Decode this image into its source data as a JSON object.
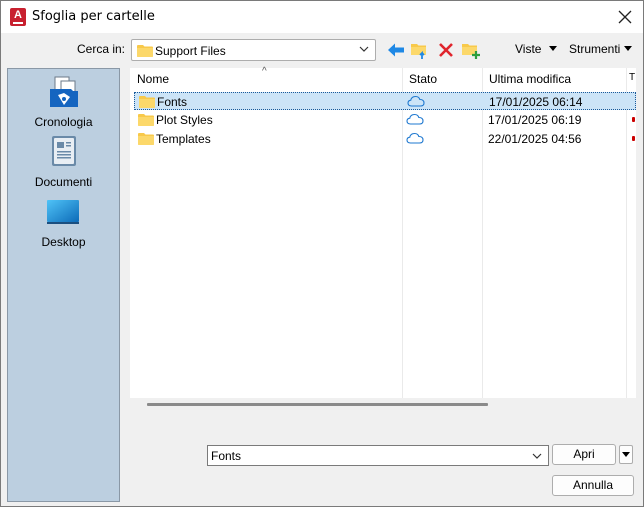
{
  "window": {
    "title": "Sfoglia per cartelle",
    "app_icon_letter": "A"
  },
  "toolbar": {
    "lookin_label": "Cerca in:",
    "lookin_value": "Support Files",
    "viste_label": "Viste",
    "strumenti_label": "Strumenti",
    "icons": [
      "back-arrow-icon",
      "folder-up-icon",
      "delete-icon",
      "new-folder-icon"
    ]
  },
  "places": [
    {
      "label": "Cronologia",
      "icon": "history-icon"
    },
    {
      "label": "Documenti",
      "icon": "documents-icon"
    },
    {
      "label": "Desktop",
      "icon": "desktop-icon"
    }
  ],
  "filelist": {
    "columns": [
      "Nome",
      "Stato",
      "Ultima modifica"
    ],
    "rows": [
      {
        "name": "Fonts",
        "status": "cloud",
        "modified": "17/01/2025 06:14",
        "selected": true
      },
      {
        "name": "Plot Styles",
        "status": "cloud",
        "modified": "17/01/2025 06:19",
        "selected": false
      },
      {
        "name": "Templates",
        "status": "cloud",
        "modified": "22/01/2025 04:56",
        "selected": false
      }
    ]
  },
  "footer": {
    "filename_value": "Fonts",
    "open_label": "Apri",
    "cancel_label": "Annulla"
  },
  "colors": {
    "places_bg": "#bccfe0",
    "selection_bg": "#cce4f7",
    "folder_yellow": "#f8c94a",
    "accent_blue": "#1e88e5",
    "delete_red": "#e0242c"
  }
}
